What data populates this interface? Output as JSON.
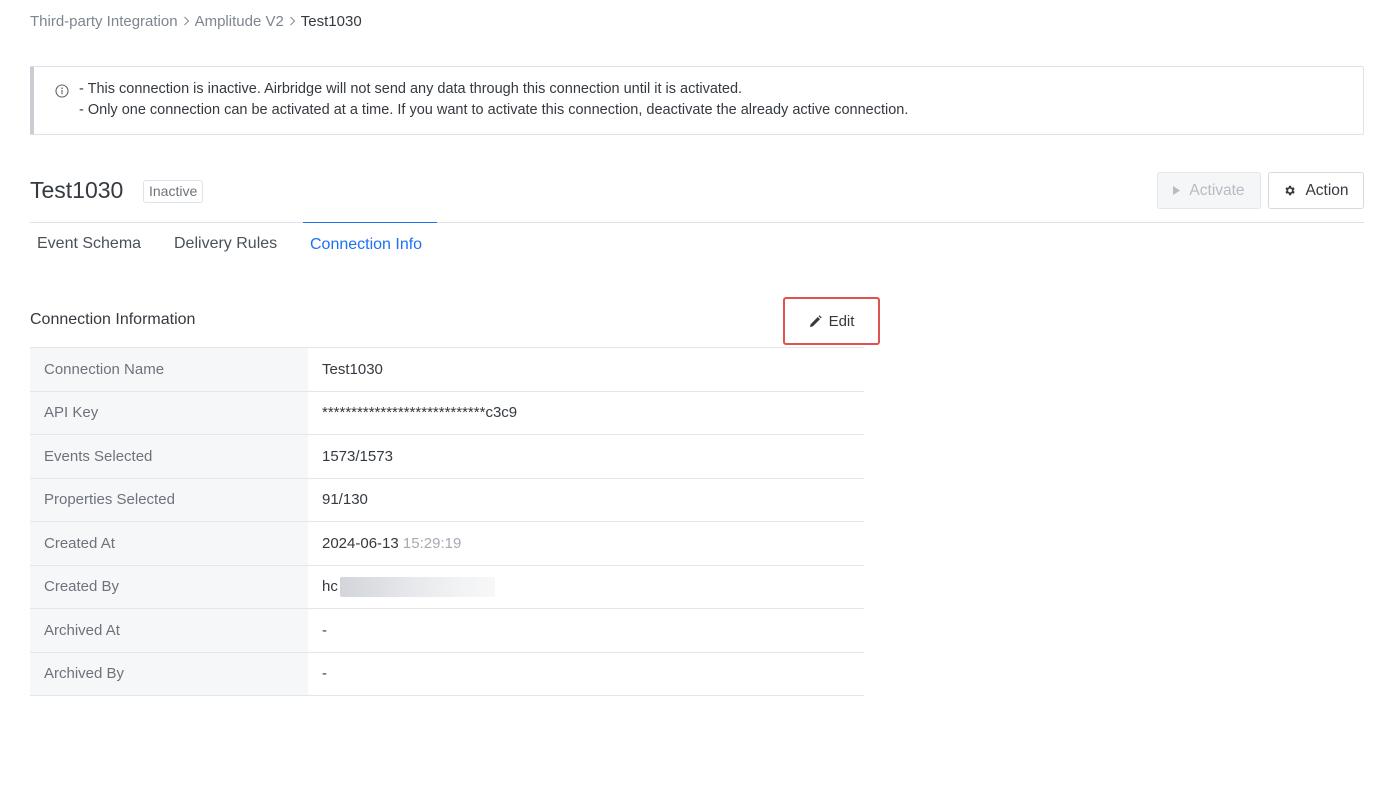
{
  "breadcrumb": {
    "items": [
      "Third-party Integration",
      "Amplitude V2",
      "Test1030"
    ]
  },
  "notice": {
    "icon": "info-icon",
    "line1": "- This connection is inactive. Airbridge will not send any data through this connection until it is activated.",
    "line2": "- Only one connection can be activated at a time. If you want to activate this connection, deactivate the already active connection."
  },
  "header": {
    "title": "Test1030",
    "status": "Inactive",
    "activate_label": "Activate",
    "action_label": "Action"
  },
  "tabs": [
    {
      "label": "Event Schema",
      "active": false
    },
    {
      "label": "Delivery Rules",
      "active": false
    },
    {
      "label": "Connection Info",
      "active": true
    }
  ],
  "section": {
    "title": "Connection Information",
    "edit_label": "Edit"
  },
  "rows": [
    {
      "label": "Connection Name",
      "value": "Test1030"
    },
    {
      "label": "API Key",
      "value": "****************************c3c9"
    },
    {
      "label": "Events Selected",
      "value": "1573/1573"
    },
    {
      "label": "Properties Selected",
      "value": "91/130"
    },
    {
      "label": "Created At",
      "date": "2024-06-13",
      "time": "15:29:19"
    },
    {
      "label": "Created By",
      "value": "hc"
    },
    {
      "label": "Archived At",
      "value": "-"
    },
    {
      "label": "Archived By",
      "value": "-"
    }
  ],
  "colors": {
    "accent": "#1d72f2",
    "highlight_border": "#e0524d",
    "label_bg": "#f6f7f9"
  }
}
